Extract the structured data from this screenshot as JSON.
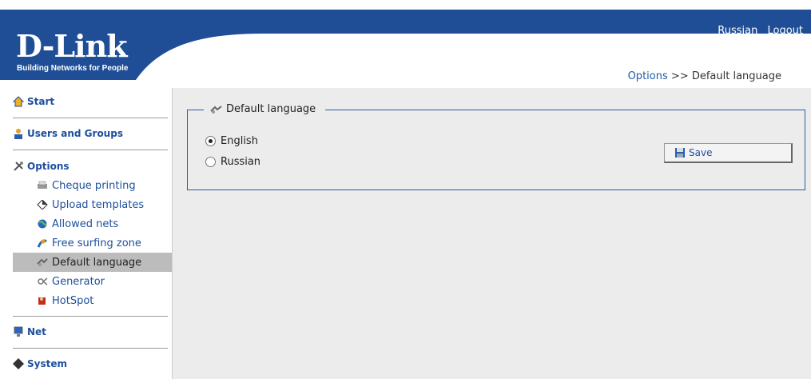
{
  "header": {
    "logo": "D-Link",
    "tagline": "Building Networks for People",
    "links": {
      "language": "Russian",
      "logout": "Logout"
    }
  },
  "breadcrumb": {
    "parent": "Options",
    "separator": ">>",
    "current": "Default language"
  },
  "sidebar": {
    "sections": {
      "start": "Start",
      "users": "Users and Groups",
      "options": "Options",
      "net": "Net",
      "system": "System"
    },
    "options_items": [
      {
        "label": "Cheque printing",
        "icon": "printer-icon"
      },
      {
        "label": "Upload templates",
        "icon": "diamond-icon"
      },
      {
        "label": "Allowed nets",
        "icon": "globe-icon"
      },
      {
        "label": "Free surfing zone",
        "icon": "surfer-icon"
      },
      {
        "label": "Default language",
        "icon": "language-icon",
        "active": true
      },
      {
        "label": "Generator",
        "icon": "generator-icon"
      },
      {
        "label": "HotSpot",
        "icon": "hotspot-icon"
      }
    ]
  },
  "main": {
    "legend": "Default language",
    "options": [
      {
        "label": "English",
        "checked": true
      },
      {
        "label": "Russian",
        "checked": false
      }
    ],
    "save_label": "Save"
  },
  "colors": {
    "brand_blue": "#1f4e96",
    "link_blue": "#1d5ea8",
    "panel_bg": "#ececec"
  }
}
